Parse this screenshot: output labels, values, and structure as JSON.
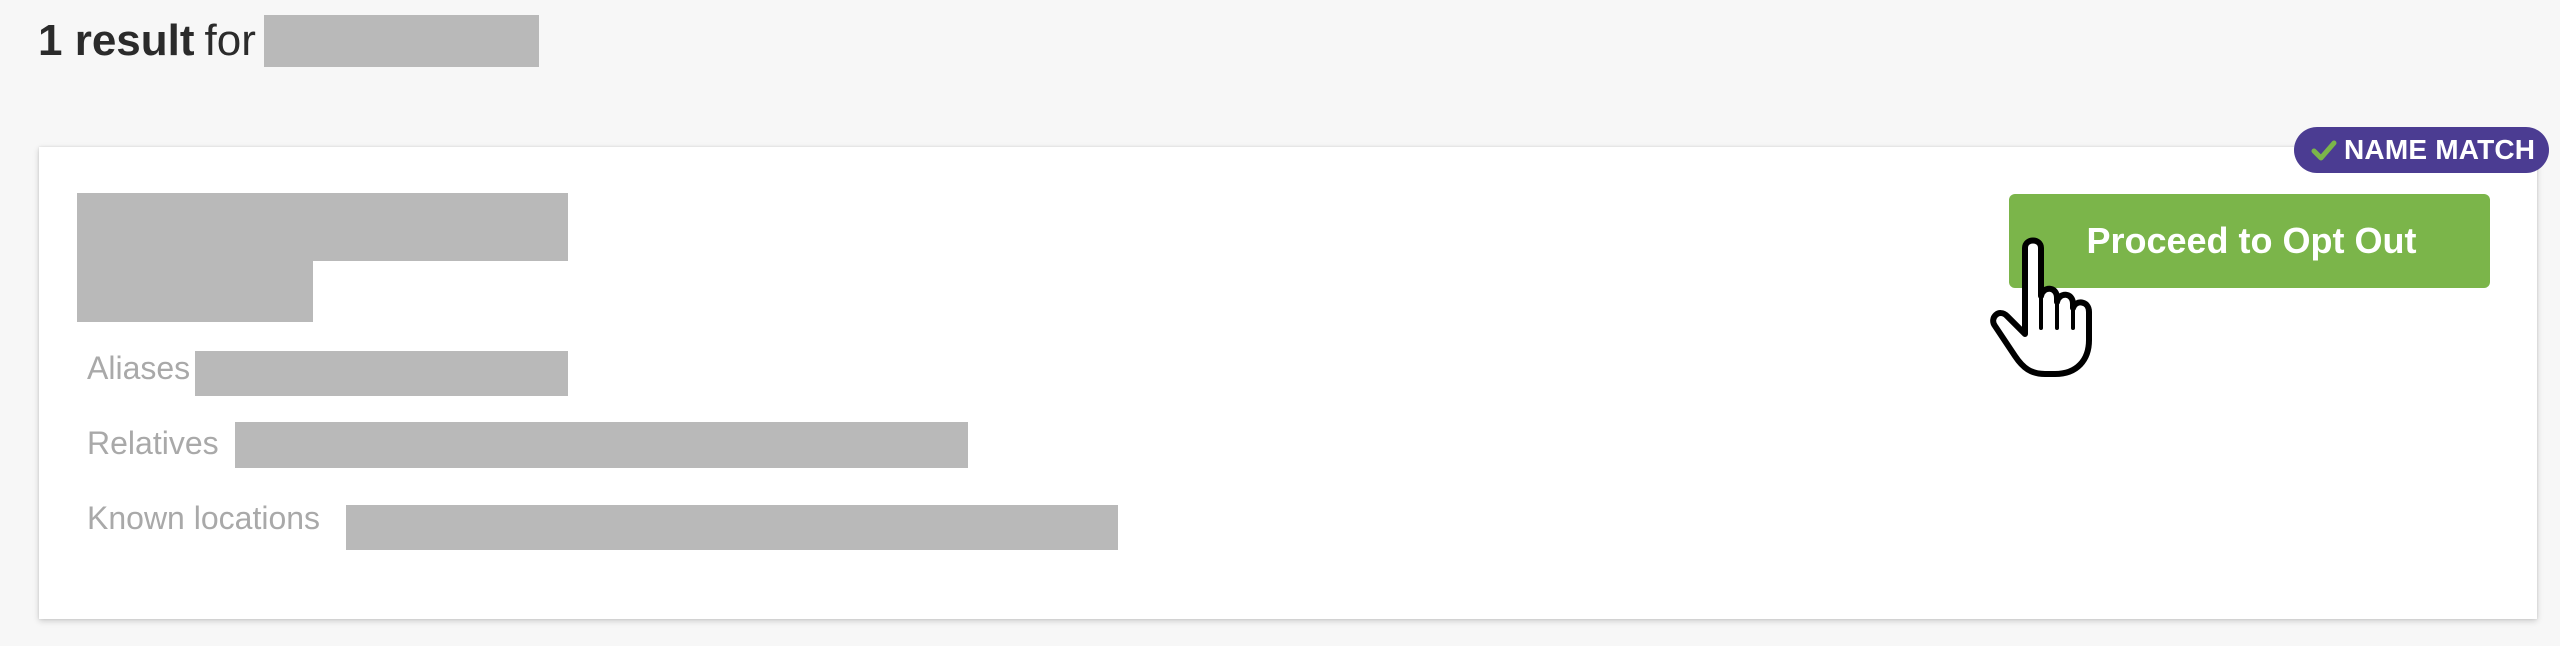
{
  "heading": {
    "count": "1 result",
    "for_word": "for"
  },
  "badge": {
    "label": "NAME MATCH",
    "icon": "check-icon"
  },
  "result": {
    "aliases_label": "Aliases",
    "relatives_label": "Relatives",
    "locations_label": "Known locations",
    "button_label": "Proceed to Opt Out"
  },
  "cursor": {
    "icon": "hand-pointer-icon"
  },
  "colors": {
    "background": "#f7f7f7",
    "badge": "#4b3c92",
    "check": "#7bb54a",
    "button": "#7bb54a",
    "redaction": "#b9b9b9",
    "label": "#a9a9a9"
  }
}
